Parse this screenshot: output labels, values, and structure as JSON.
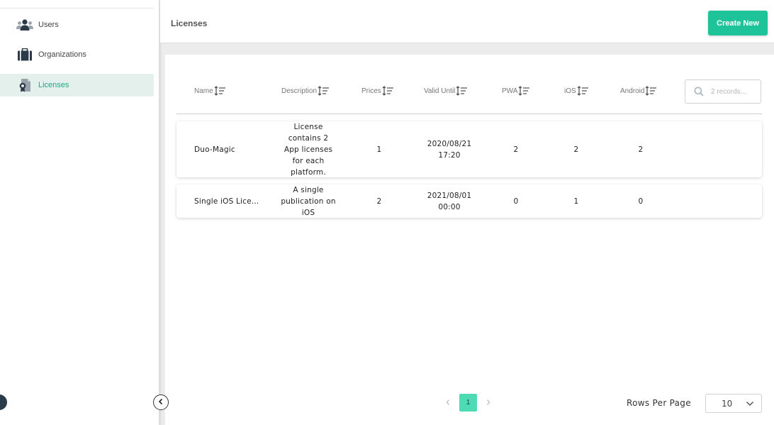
{
  "sidebar": {
    "items": [
      {
        "label": "Users",
        "icon": "users-icon"
      },
      {
        "label": "Organizations",
        "icon": "briefcase-icon"
      },
      {
        "label": "Licenses",
        "icon": "license-icon",
        "active": true
      }
    ]
  },
  "header": {
    "title": "Licenses",
    "create_label": "Create New"
  },
  "table": {
    "columns": [
      "Name",
      "Description",
      "Prices",
      "Valid Until",
      "PWA",
      "iOS",
      "Android"
    ],
    "search_placeholder": "2 records...",
    "rows": [
      {
        "name": "Duo-Magic",
        "description_lines": [
          "License",
          "contains 2",
          "App licenses",
          "for each",
          "platform."
        ],
        "prices": "1",
        "valid_until_lines": [
          "2020/08/21",
          "17:20"
        ],
        "pwa": "2",
        "ios": "2",
        "android": "2"
      },
      {
        "name": "Single iOS Lice…",
        "description_lines": [
          "A single",
          "publication on",
          "iOS"
        ],
        "prices": "2",
        "valid_until_lines": [
          "2021/08/01",
          "00:00"
        ],
        "pwa": "0",
        "ios": "1",
        "android": "0"
      }
    ]
  },
  "pagination": {
    "current_page": "1",
    "rows_per_page_label": "Rows Per Page",
    "rows_per_page_value": "10"
  },
  "colors": {
    "accent": "#1fc39a",
    "active_bg": "#e3f0ec",
    "page_active": "#4ddbb5"
  }
}
